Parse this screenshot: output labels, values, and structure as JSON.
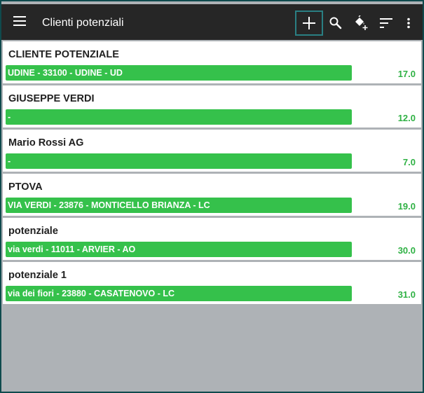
{
  "toolbar": {
    "menu_icon": "hamburger-menu-icon",
    "title": "Clienti potenziali",
    "actions": [
      "add-icon",
      "search-icon",
      "paint-bucket-add-icon",
      "sort-icon",
      "more-vertical-icon"
    ]
  },
  "colors": {
    "toolbar_bg": "#262626",
    "accent": "#35c14b",
    "value_text": "#2fb144",
    "frame": "#0f4a4d",
    "empty_area": "#aeb2b6"
  },
  "clients": [
    {
      "name": "CLIENTE POTENZIALE",
      "address": "UDINE - 33100 - UDINE - UD",
      "value": "17.0"
    },
    {
      "name": "GIUSEPPE VERDI",
      "address": "-",
      "value": "12.0"
    },
    {
      "name": "Mario Rossi AG",
      "address": "-",
      "value": "7.0"
    },
    {
      "name": "PTOVA",
      "address": "VIA VERDI - 23876 - MONTICELLO BRIANZA - LC",
      "value": "19.0"
    },
    {
      "name": "potenziale",
      "address": "via verdi - 11011 - ARVIER - AO",
      "value": "30.0"
    },
    {
      "name": "potenziale 1",
      "address": "via dei fiori - 23880 - CASATENOVO - LC",
      "value": "31.0"
    }
  ]
}
